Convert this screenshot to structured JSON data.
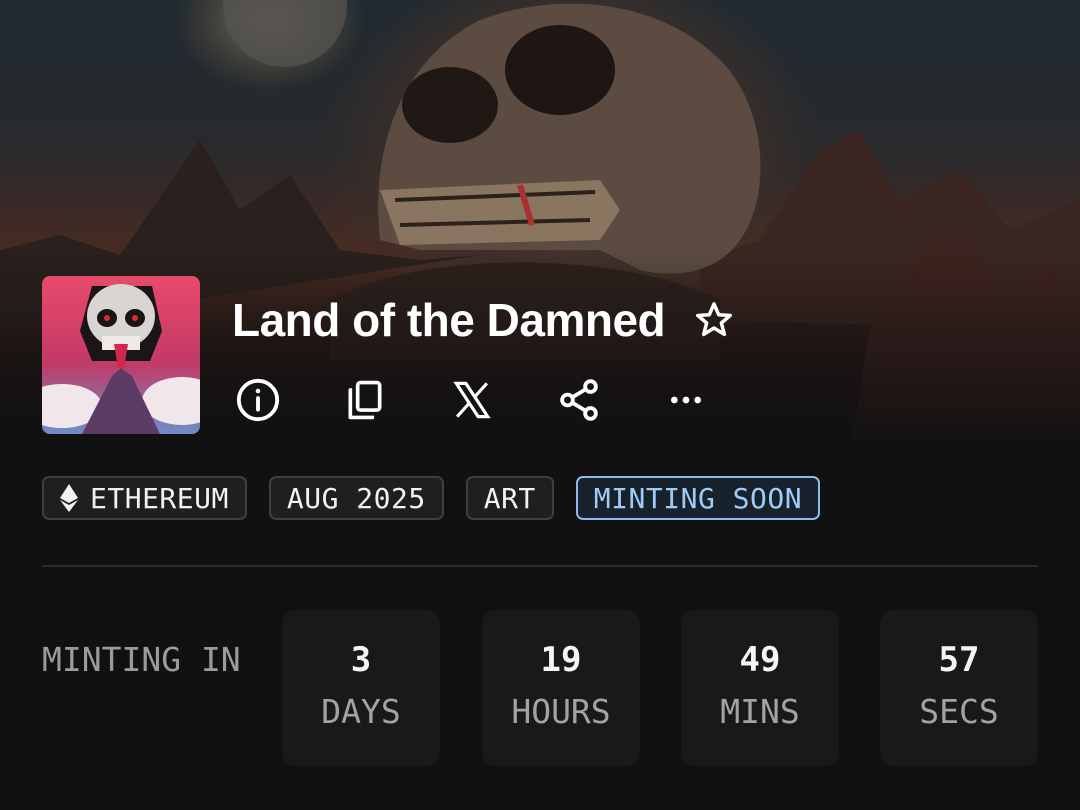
{
  "collection": {
    "name": "Land of the Damned",
    "favorite": false
  },
  "actions": [
    {
      "icon": "info-icon"
    },
    {
      "icon": "copy-icon"
    },
    {
      "icon": "x-logo-icon"
    },
    {
      "icon": "share-icon"
    },
    {
      "icon": "more-icon"
    }
  ],
  "tags": {
    "chain": "ETHEREUM",
    "date": "AUG 2025",
    "category": "ART",
    "status": "MINTING SOON"
  },
  "countdown": {
    "label": "MINTING IN",
    "days": {
      "value": "3",
      "unit": "DAYS"
    },
    "hours": {
      "value": "19",
      "unit": "HOURS"
    },
    "mins": {
      "value": "49",
      "unit": "MINS"
    },
    "secs": {
      "value": "57",
      "unit": "SECS"
    }
  },
  "colors": {
    "background": "#111111",
    "status_accent": "#9fcbf5"
  }
}
